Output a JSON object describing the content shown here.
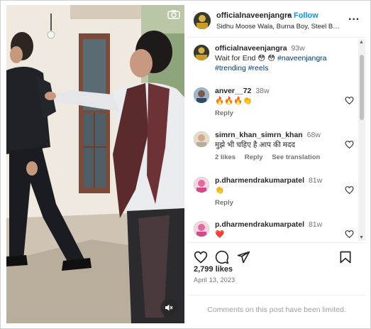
{
  "post": {
    "username": "officialnaveenjangra",
    "separator": "•",
    "follow_label": "Follow",
    "audio": "Sidhu Moose Wala, Burna Boy, Steel Banglez · Mera Na",
    "more_label": "···"
  },
  "caption": {
    "username": "officialnaveenjangra",
    "time": "93w",
    "text": "Wait for End 😳 😳",
    "tag1": "#naveenjangra",
    "tag2": "#trending",
    "tag3": "#reels"
  },
  "comments": [
    {
      "username": "anver__72",
      "time": "38w",
      "text": "🔥🔥🔥👏",
      "reply": "Reply"
    },
    {
      "username": "simrn_khan_simrn_khan",
      "time": "68w",
      "text": "मुझे भी चहिए है आप की मदद",
      "likes": "2 likes",
      "reply": "Reply",
      "translate": "See translation"
    },
    {
      "username": "p.dharmendrakumarpatel",
      "time": "81w",
      "text": "👏",
      "reply": "Reply"
    },
    {
      "username": "p.dharmendrakumarpatel",
      "time": "81w",
      "text": "❤️"
    }
  ],
  "likes": "2,799 likes",
  "date": "April 13, 2023",
  "limited_notice": "Comments on this post have been limited.",
  "icons": [
    "camera-icon",
    "mute-icon",
    "more-icon",
    "heart-icon",
    "comment-icon",
    "share-icon",
    "bookmark-icon"
  ],
  "colors": {
    "follow": "#0095f6",
    "tag": "#00376b",
    "muted": "#737373",
    "heart_red": "#ed4956"
  }
}
